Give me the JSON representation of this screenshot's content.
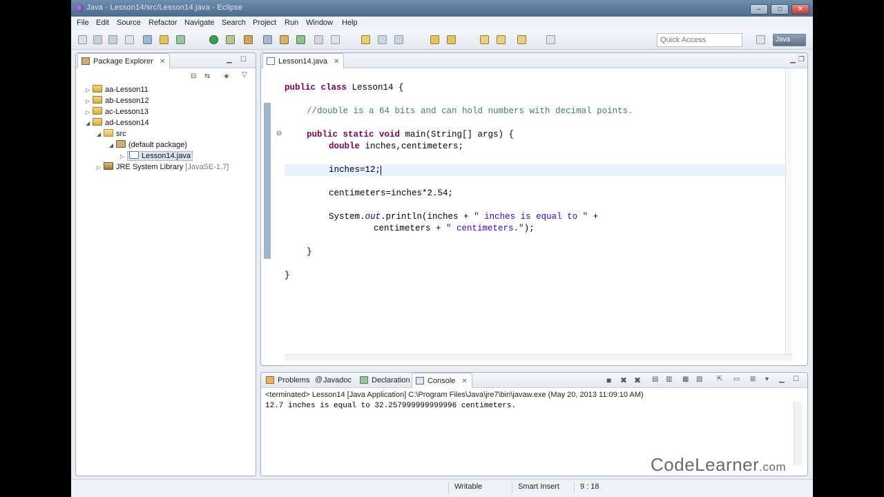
{
  "window": {
    "title": "Java - Lesson14/src/Lesson14.java - Eclipse",
    "controls": {
      "minimize": "–",
      "maximize": "□",
      "close": "✕"
    }
  },
  "menu": [
    "File",
    "Edit",
    "Source",
    "Refactor",
    "Navigate",
    "Search",
    "Project",
    "Run",
    "Window",
    "Help"
  ],
  "toolbar": {
    "quick_access_placeholder": "Quick Access",
    "perspective_label": "Java"
  },
  "explorer": {
    "tab_label": "Package Explorer",
    "tree": {
      "projects": [
        "aa-Lesson11",
        "ab-Lesson12",
        "ac-Lesson13",
        "ad-Lesson14"
      ],
      "src": "src",
      "default_package": "(default package)",
      "file": "Lesson14.java",
      "jre_name": "JRE System Library",
      "jre_version": "[JavaSE-1.7]"
    }
  },
  "editor": {
    "tab_label": "Lesson14.java",
    "code": {
      "l1_kw": "public class",
      "l1_rest": " Lesson14 {",
      "l2_comment": "//double is a 64 bits and can hold numbers with decimal points.",
      "l3_kw": "public static void",
      "l3_rest": " main(String[] args) {",
      "l4_kw": "double",
      "l4_rest": " inches,centimeters;",
      "l5": "inches=12;",
      "l6": "centimeters=inches*2.54;",
      "l7_a": "System.",
      "l7_out": "out",
      "l7_b": ".println(inches + ",
      "l7_str": "\" inches is equal to \"",
      "l7_c": " +",
      "l8_a": "centimeters + ",
      "l8_str": "\" centimeters.\"",
      "l8_b": ");",
      "l9": "}",
      "l10": "}"
    }
  },
  "bottom_tabs": [
    "Problems",
    "Javadoc",
    "Declaration",
    "Console"
  ],
  "console": {
    "header": "<terminated> Lesson14 [Java Application] C:\\Program Files\\Java\\jre7\\bin\\javaw.exe (May 20, 2013 11:09:10 AM)",
    "output": "12.7 inches is equal to 32.257999999999996 centimeters."
  },
  "watermark": {
    "main": "CodeLearner",
    "suffix": ".com"
  },
  "statusbar": {
    "writable": "Writable",
    "insert_mode": "Smart Insert",
    "position": "9 : 18"
  }
}
